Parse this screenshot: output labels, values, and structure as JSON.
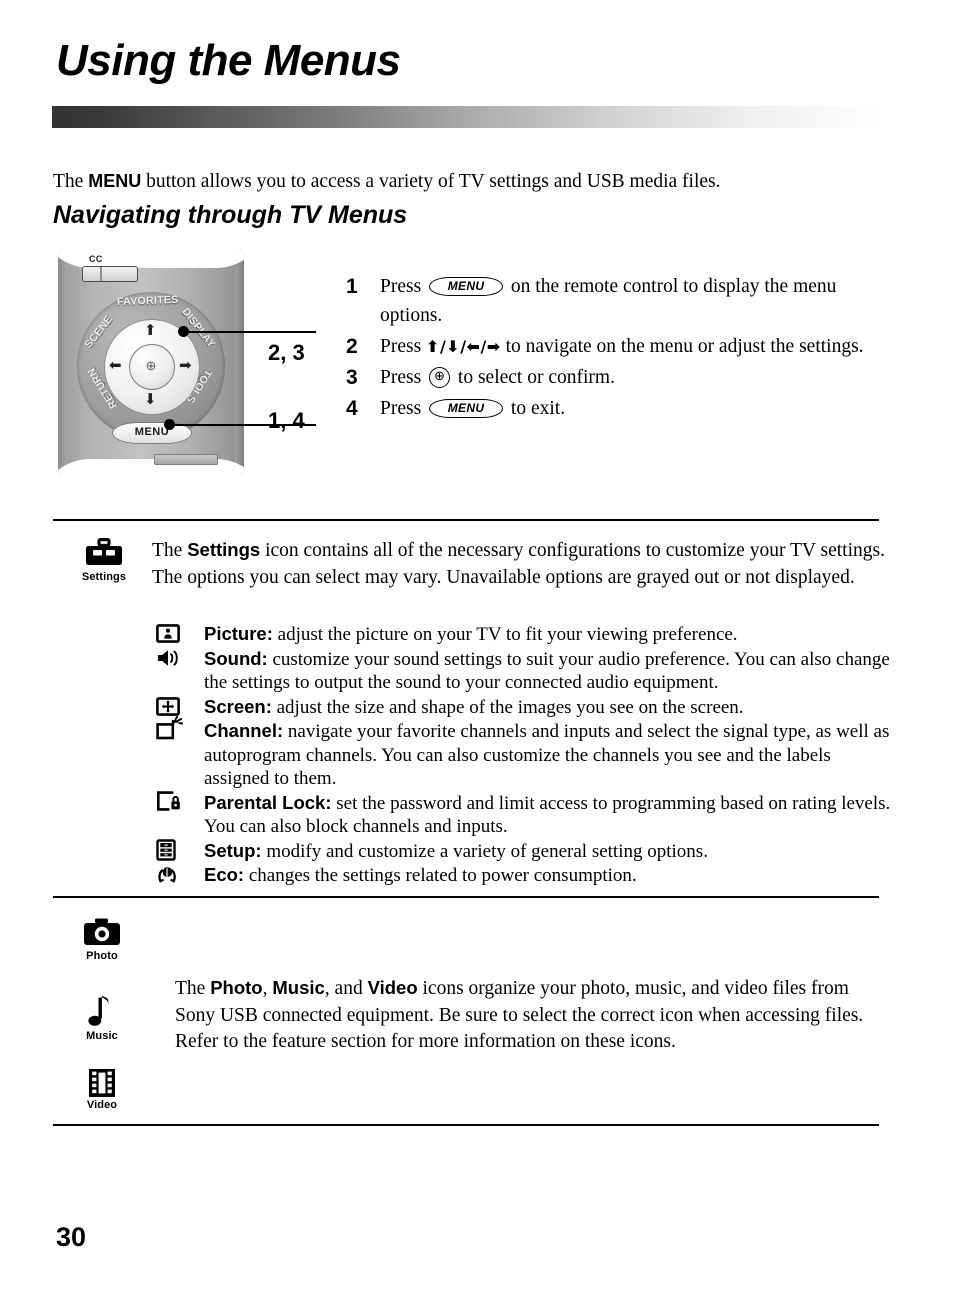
{
  "page": {
    "title": "Using the Menus",
    "number": "30"
  },
  "intro": {
    "before": "The ",
    "bold": "MENU",
    "after": " button allows you to access a variety of TV settings and USB media files.",
    "subtitle": "Navigating through TV Menus"
  },
  "remote": {
    "cc_label": "CC",
    "menu_key": "MENU",
    "ring_labels": {
      "favorites": "FAVORITES",
      "scene": "SCENE",
      "display": "DISPLAY",
      "return": "RETURN",
      "tools": "TOOLS"
    },
    "callouts": [
      {
        "text": "2, 3"
      },
      {
        "text": "1, 4"
      }
    ]
  },
  "steps": [
    {
      "num": "1",
      "pre": "Press ",
      "glyph": "MENU",
      "post": " on the remote control to display the menu options."
    },
    {
      "num": "2",
      "pre": "Press ",
      "arrows": "⬆/⬇/⬅/➡",
      "post": " to navigate on the menu or adjust the settings."
    },
    {
      "num": "3",
      "pre": "Press ",
      "glyph": "select",
      "post": " to select or confirm."
    },
    {
      "num": "4",
      "pre": "Press ",
      "glyph": "MENU",
      "post": " to exit."
    }
  ],
  "settings": {
    "icon_caption": "Settings",
    "text_before": "The ",
    "text_bold": "Settings",
    "text_after": " icon contains all of the necessary configurations to customize your TV settings. The options you can select may vary. Unavailable options are grayed out or not displayed.",
    "items": [
      {
        "icon": "picture-icon",
        "label": "Picture:",
        "desc": " adjust the picture on your TV to fit your viewing preference."
      },
      {
        "icon": "sound-icon",
        "label": "Sound:",
        "desc": " customize your sound settings to suit your audio preference. You can also change the settings to output the sound to your connected audio equipment."
      },
      {
        "icon": "screen-icon",
        "label": "Screen:",
        "desc": " adjust the size and shape of the images you see on the screen."
      },
      {
        "icon": "channel-icon",
        "label": "Channel:",
        "desc": " navigate your favorite channels and inputs and select the signal type, as well as autoprogram channels. You can also customize the channels you see and the labels assigned to them."
      },
      {
        "icon": "parental-lock-icon",
        "label": "Parental Lock:",
        "desc": " set the password and limit access to programming based on rating levels. You can also block channels and inputs."
      },
      {
        "icon": "setup-icon",
        "label": "Setup:",
        "desc": " modify and customize a variety of general setting options."
      },
      {
        "icon": "eco-icon",
        "label": "Eco:",
        "desc": " changes the settings related to power consumption."
      }
    ]
  },
  "media": {
    "photo_caption": "Photo",
    "music_caption": "Music",
    "video_caption": "Video",
    "text_1": "The ",
    "bold_1": "Photo",
    "text_2": ", ",
    "bold_2": "Music",
    "text_3": ", and ",
    "bold_3": "Video",
    "text_4": " icons organize your photo, music, and video files from Sony USB connected equipment. Be sure to select the correct icon when accessing files. Refer to the feature section for more information on these icons."
  }
}
